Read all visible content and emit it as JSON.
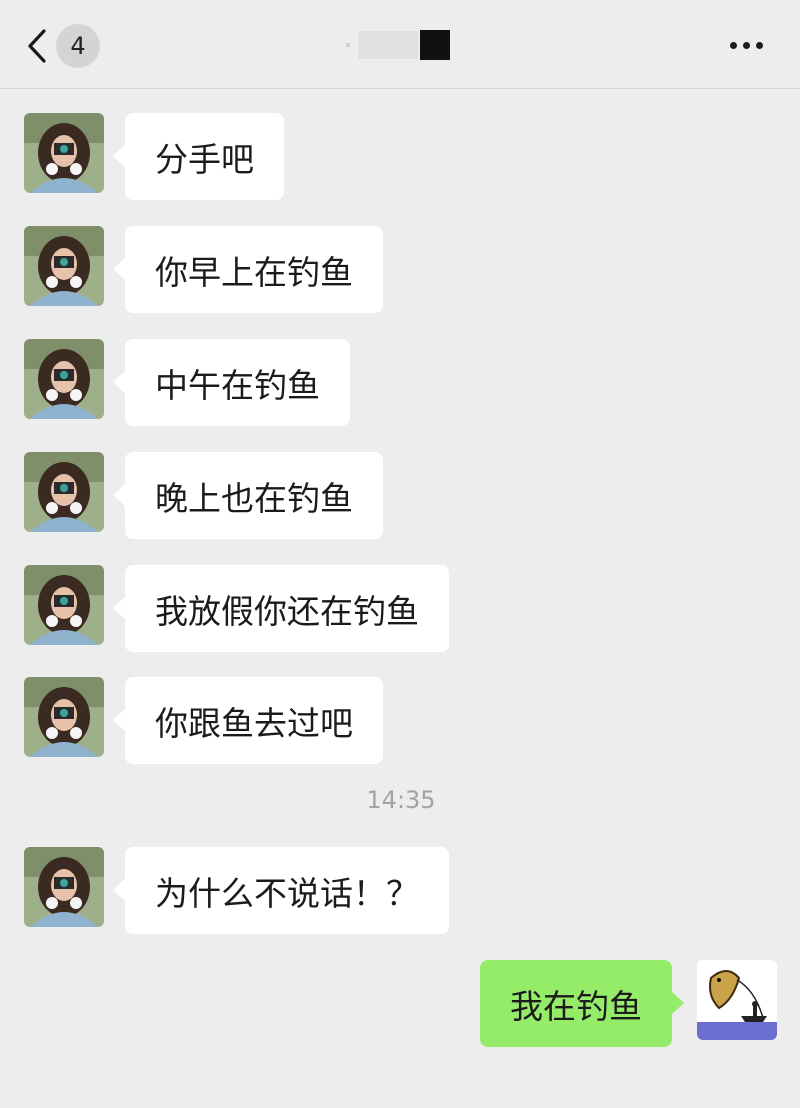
{
  "header": {
    "back_badge": "4"
  },
  "messages": [
    {
      "sender": "other",
      "text": "分手吧"
    },
    {
      "sender": "other",
      "text": "你早上在钓鱼"
    },
    {
      "sender": "other",
      "text": "中午在钓鱼"
    },
    {
      "sender": "other",
      "text": "晚上也在钓鱼"
    },
    {
      "sender": "other",
      "text": "我放假你还在钓鱼"
    },
    {
      "sender": "other",
      "text": "你跟鱼去过吧"
    },
    {
      "sender": "other",
      "text": "为什么不说话！？"
    },
    {
      "sender": "me",
      "text": "我在钓鱼"
    }
  ],
  "timestamp": "14:35",
  "icons": {
    "back": "chevron-left-icon",
    "more": "more-dots-icon"
  }
}
